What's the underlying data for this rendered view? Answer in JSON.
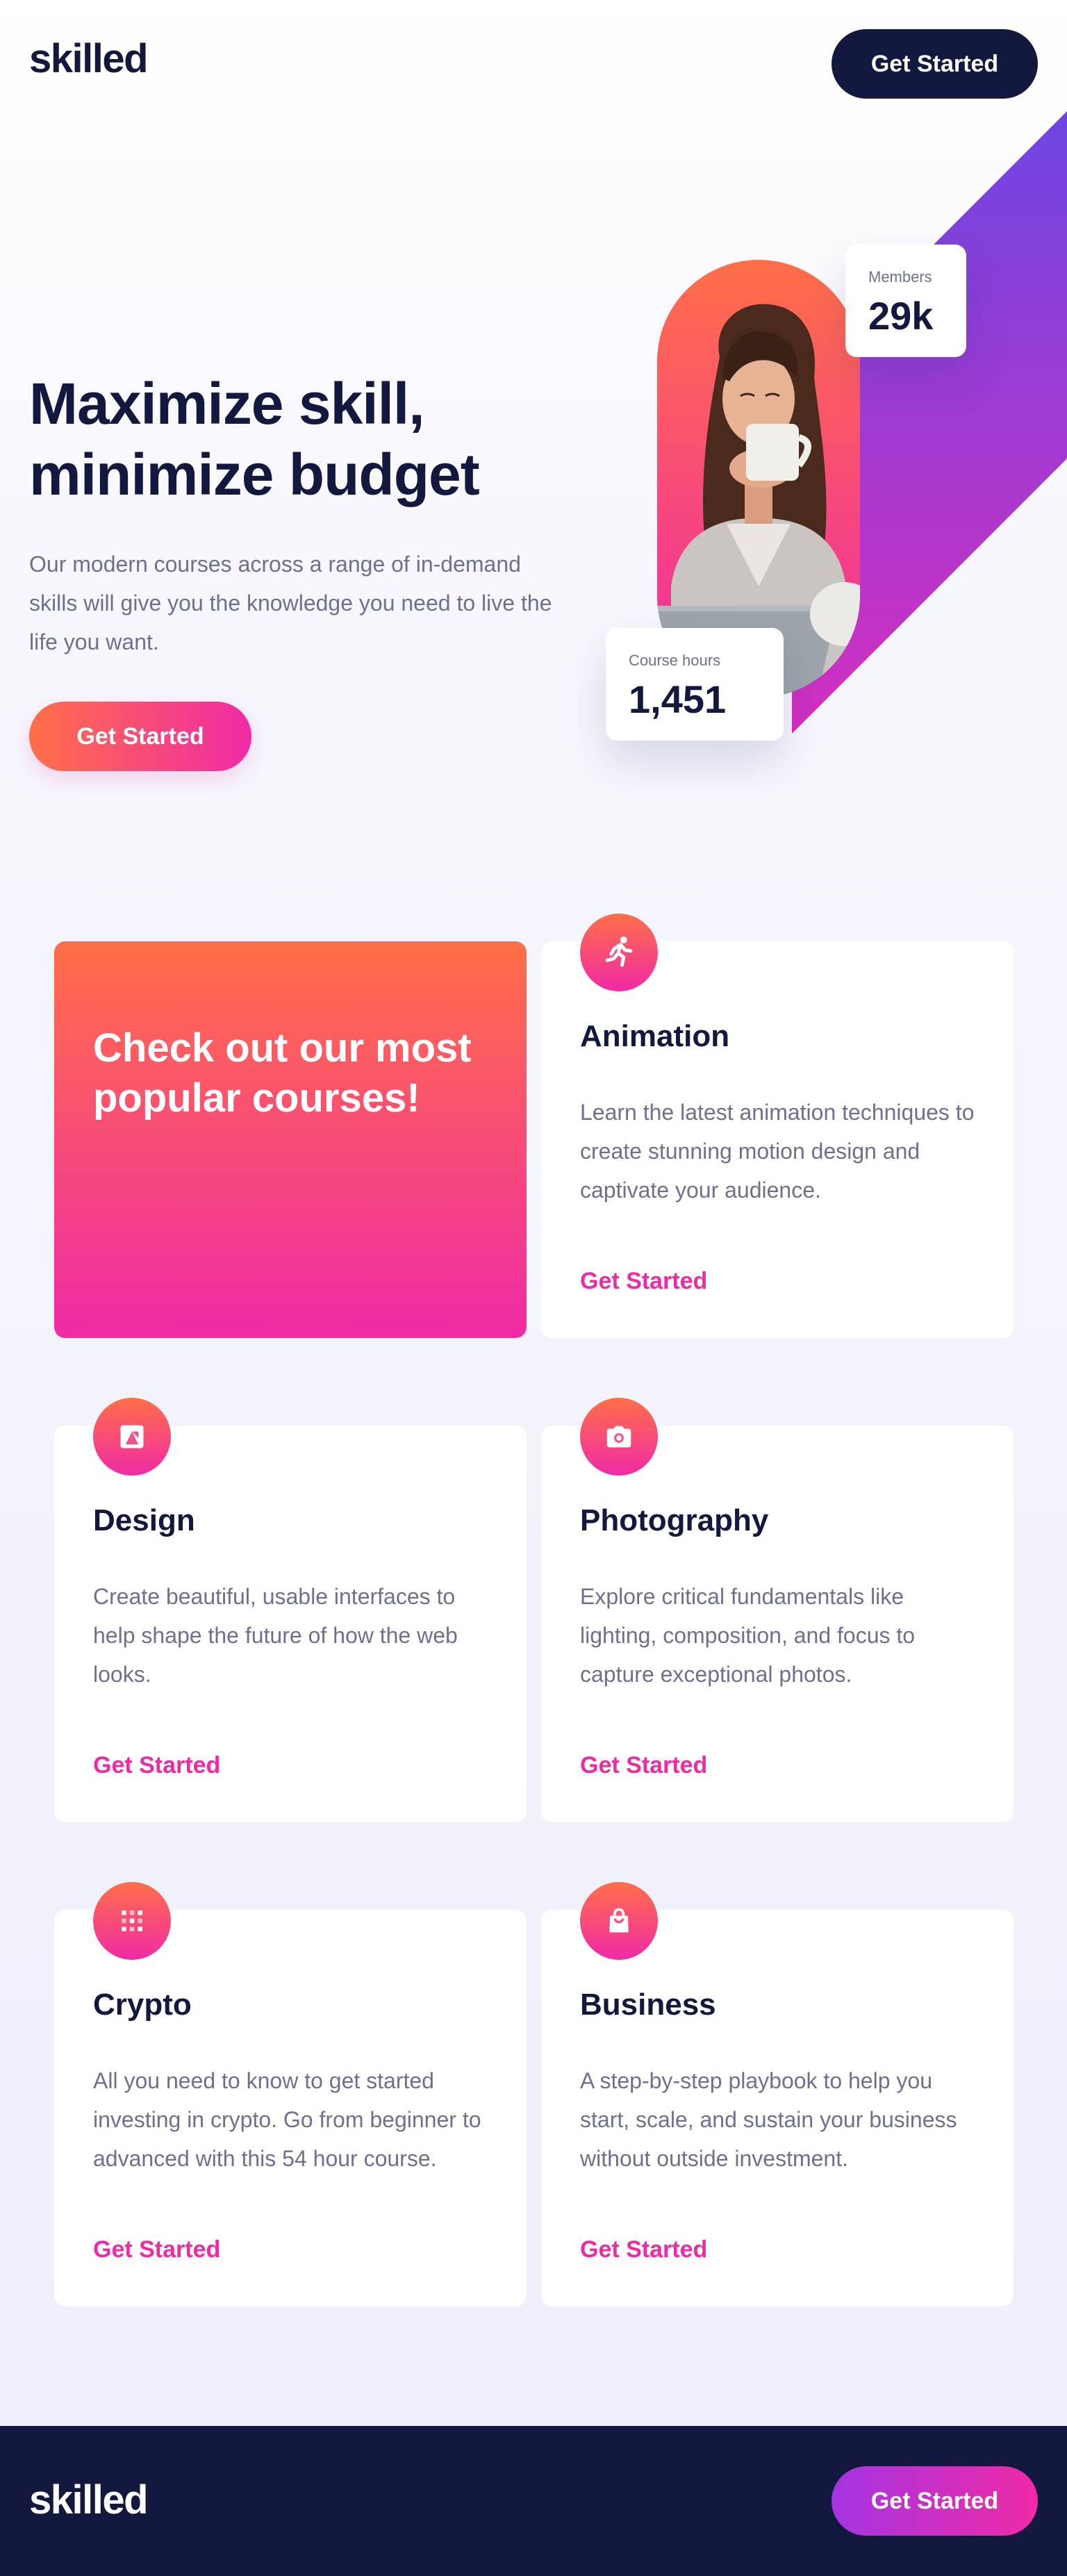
{
  "brand": {
    "logo": "skilled"
  },
  "header": {
    "cta_label": "Get Started"
  },
  "hero": {
    "title": "Maximize skill, minimize budget",
    "description": "Our modern courses across a range of in-demand skills will give you the knowledge you need to live the life you want.",
    "cta_label": "Get Started",
    "stats": {
      "members": {
        "label": "Members",
        "value": "29k"
      },
      "course_hours": {
        "label": "Course hours",
        "value": "1,451"
      }
    }
  },
  "courses": {
    "promo_title": "Check out our most popular courses!",
    "items": [
      {
        "icon": "running-figure-icon",
        "title": "Animation",
        "description": "Learn the latest animation techniques to create stunning motion design and captivate your audience.",
        "link": "Get Started"
      },
      {
        "icon": "design-icon",
        "title": "Design",
        "description": "Create beautiful, usable interfaces to help shape the future of how the web looks.",
        "link": "Get Started"
      },
      {
        "icon": "camera-icon",
        "title": "Photography",
        "description": "Explore critical fundamentals like lighting, composition, and focus to capture exceptional photos.",
        "link": "Get Started"
      },
      {
        "icon": "crypto-icon",
        "title": "Crypto",
        "description": "All you need to know to get started investing in crypto. Go from beginner to advanced with this 54 hour course.",
        "link": "Get Started"
      },
      {
        "icon": "shopping-bag-icon",
        "title": "Business",
        "description": "A step-by-step playbook to help you start, scale, and sustain your business without outside investment.",
        "link": "Get Started"
      }
    ]
  },
  "footer": {
    "logo": "skilled",
    "cta_label": "Get Started"
  },
  "colors": {
    "navy": "#13183f",
    "orange": "#ff6f48",
    "pink": "#f02aa6",
    "purple": "#6e45e2",
    "gray_text": "#6d7091"
  }
}
